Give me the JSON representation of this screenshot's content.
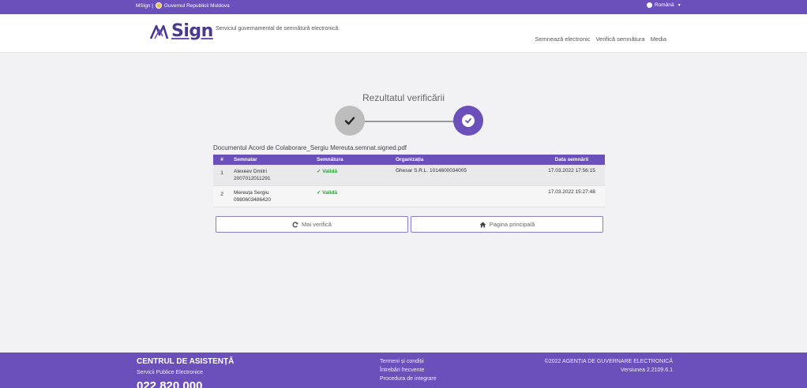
{
  "govbar": {
    "left_text_1": "MSign |",
    "left_text_2": "Guvernul Republicii Moldova",
    "language": "Română"
  },
  "header": {
    "logo_text": "Sign",
    "subtitle": "Serviciul guvernamental de semnătură electronică",
    "nav": [
      "Semnează electronic",
      "Verifică semnătura",
      "Media"
    ]
  },
  "main": {
    "title": "Rezultatul verificării",
    "document_label": "Documentul Acord de Colaborare_Sergiu Mereuta.semnat.signed.pdf",
    "table": {
      "headers": [
        "#",
        "Semnatar",
        "Semnătura",
        "Organizația",
        "Data semnării"
      ],
      "rows": [
        {
          "num": "1",
          "name": "Alexeev Dmitri",
          "idnp": "2007012011291",
          "status": "Validă",
          "org": "Ghesar S.R.L. 1014600034005",
          "date": "17.03.2022 17:56:15"
        },
        {
          "num": "2",
          "name": "Mereuța Sergiu",
          "idnp": "0980603486420",
          "status": "Validă",
          "org": "",
          "date": "17.03.2022 15:27:48"
        }
      ]
    },
    "buttons": {
      "recheck": "Mai verifică",
      "home": "Pagina principală"
    }
  },
  "footer": {
    "title": "CENTRUL DE ASISTENȚĂ",
    "subtitle": "Servicii Publice Electronice",
    "phone": "022 820 000",
    "links": [
      "Termeni și condiții",
      "Întrebări frecvente",
      "Procedura de integrare"
    ],
    "copyright": "©2022 AGENȚIA DE GUVERNARE ELECTRONICĂ",
    "version": "Versiunea 2.2109.6.1"
  },
  "colors": {
    "brand": "#6b4fbb",
    "valid": "#2e9c3b"
  }
}
